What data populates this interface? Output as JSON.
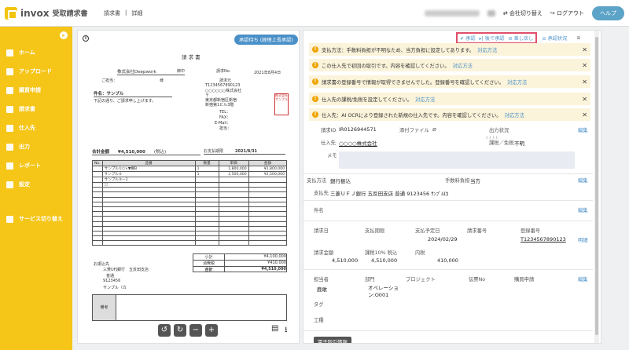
{
  "header": {
    "logo_text": "invox",
    "app_name": "受取請求書",
    "crumb_parent": "請求書",
    "crumb_sep": "|",
    "crumb_current": "詳細",
    "switch_company": "会社切り替え",
    "logout": "ログアウト",
    "help": "ヘルプ"
  },
  "sidebar": {
    "items": [
      {
        "label": "ホーム",
        "icon": "home-icon"
      },
      {
        "label": "アップロード",
        "icon": "upload-icon"
      },
      {
        "label": "購買申請",
        "icon": "purchase-icon"
      },
      {
        "label": "請求書",
        "icon": "invoice-icon"
      },
      {
        "label": "仕入先",
        "icon": "supplier-icon"
      },
      {
        "label": "出力",
        "icon": "export-icon"
      },
      {
        "label": "レポート",
        "icon": "report-icon"
      },
      {
        "label": "設定",
        "icon": "settings-icon"
      },
      {
        "label": "サービス切り替え",
        "icon": "switch-icon"
      }
    ]
  },
  "doc": {
    "status": "承認待ち (経理上長承認)",
    "title": "請 求 書",
    "date": "2021年8月4日",
    "invoice_no_label": "請求No.",
    "company_to": "株式会社Deepwork",
    "honorific": "御中",
    "customer_label": "ご担当：",
    "sama": "様",
    "issuer_label": "請求元",
    "issuer_no": "T1234567890123",
    "issuer_name": "○○○○○○株式会社",
    "postal": "〒",
    "address1": "東京都新宿区新宿",
    "address2": "新宿第1ビル3階",
    "tel": "TEL：",
    "fax": "FAX：",
    "email": "E-Mail：",
    "contact": "担当：",
    "subject_label": "件名：",
    "subject": "サンプル",
    "greeting": "下記の通り、ご請求申し上げます。",
    "total_label": "合計金額",
    "total": "¥4,510,000",
    "tax_note": "(税込)",
    "due_label": "お支払期限",
    "due": "2021/8/31",
    "table_headers": [
      "No.",
      "品番",
      "数量",
      "単価",
      "金額"
    ],
    "rows": [
      [
        "",
        "サンプル①○×▼棚B",
        "1",
        "1,800,000",
        "¥1,800,000"
      ],
      [
        "",
        "サンプル②",
        "1",
        "2,500,000",
        "¥2,500,000"
      ],
      [
        "",
        "サンプル③ー2",
        "",
        "",
        " "
      ],
      [
        "",
        "□",
        "",
        "",
        ""
      ]
    ],
    "bank_label": "お振込先",
    "bank1": "三菱UFJ銀行　五反田支店",
    "bank2": "普通",
    "bank3": "9123456",
    "bank4": "サンプル（カ",
    "subtotal_label": "小計",
    "subtotal": "¥4,100,000",
    "tax_label": "消費税",
    "tax": "¥410,000",
    "sum_label": "合計",
    "sum": "¥4,510,000",
    "remarks_label": "備考",
    "stamp_text": "株式会社サンプル"
  },
  "right": {
    "actions": [
      "承認",
      "後で承認",
      "差し戻し"
    ],
    "approval_status": "承認状況",
    "warnings": [
      {
        "text": "支払方法：手数料負担が不明なため、当方負担に設定してあります。",
        "link": "対応方法"
      },
      {
        "text": "この仕入先で初回の取引です。内容を確認してください。",
        "link": "対応方法"
      },
      {
        "text": "請求書の登録番号で情報が取得できませんでした。登録番号を確認してください。",
        "link": "対応方法"
      },
      {
        "text": "仕入先の課税/免税を設定してください。",
        "link": "対応方法"
      },
      {
        "text": "仕入先：AI OCRにより登録された新規の仕入先です。内容を確認してください。",
        "link": "対応方法"
      }
    ],
    "invoice_id_label": "請求ID",
    "invoice_id": "IR0126944571",
    "attach_label": "添付ファイル",
    "output_label": "出力状況",
    "supplier_label": "仕入先",
    "supplier": "○○○○株式会社",
    "tax_type_label": "課税／免税",
    "tax_type": "不明",
    "memo_label": "メモ",
    "pay_method_label": "支払方法",
    "pay_method": "銀行振込",
    "fee_label": "手数料負担",
    "fee": "当方",
    "pay_to_label": "支払先",
    "pay_to": "三菱ＵＦＪ銀行 五反田支店 普通 9123456 ｻﾝﾌﾟﾙ(ｶ",
    "subject_label": "件名",
    "invoice_date_label": "請求日",
    "due_label": "支払期限",
    "planned_label": "支払予定日",
    "planned": "2024/02/29",
    "invoice_no_label": "請求番号",
    "reg_no_label": "登録番号",
    "reg_no": "T1234567890123",
    "detail": "明細",
    "amount_label": "請求金額",
    "amount": "4,510,000",
    "tax10_label": "課税10% 税込",
    "tax10": "4,510,000",
    "breakdown_label": "内税",
    "breakdown": "410,000",
    "person_label": "担当者",
    "person": "鹿敢",
    "dept_label": "部門",
    "dept": "オペレーション:O001",
    "project_label": "プロジェクト",
    "slip_label": "伝票No",
    "purchase_label": "購買申請",
    "tag_label": "タグ",
    "work_label": "工種",
    "edit": "編集",
    "e_tag": "電子取引情報"
  }
}
